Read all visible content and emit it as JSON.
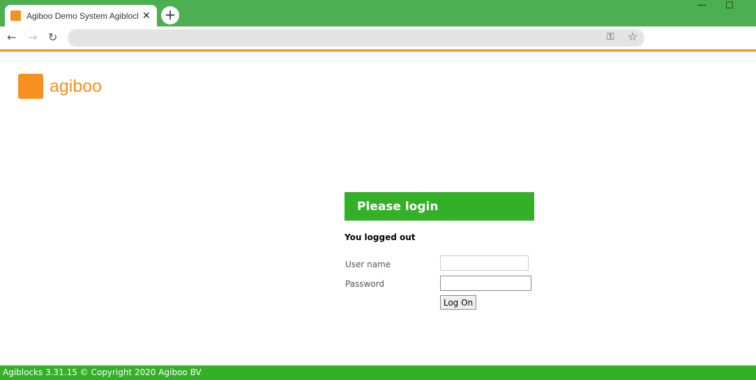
{
  "browser": {
    "tab_title": "Agiboo Demo System Agiblocks",
    "new_tab": "+",
    "close": "✕",
    "minimize": "—",
    "maximize": "☐",
    "back": "←",
    "forward": "→",
    "reload": "↻",
    "key": "⚿",
    "star": "☆"
  },
  "logo": {
    "text": "agiboo"
  },
  "login": {
    "title": "Please login",
    "message": "You logged out",
    "username_label": "User name",
    "password_label": "Password",
    "username_value": "",
    "password_value": "",
    "button": "Log On"
  },
  "footer": {
    "text": "Agiblocks 3.31.15 © Copyright 2020  Agiboo BV"
  },
  "colors": {
    "green": "#33b027",
    "orange": "#f7901e"
  }
}
